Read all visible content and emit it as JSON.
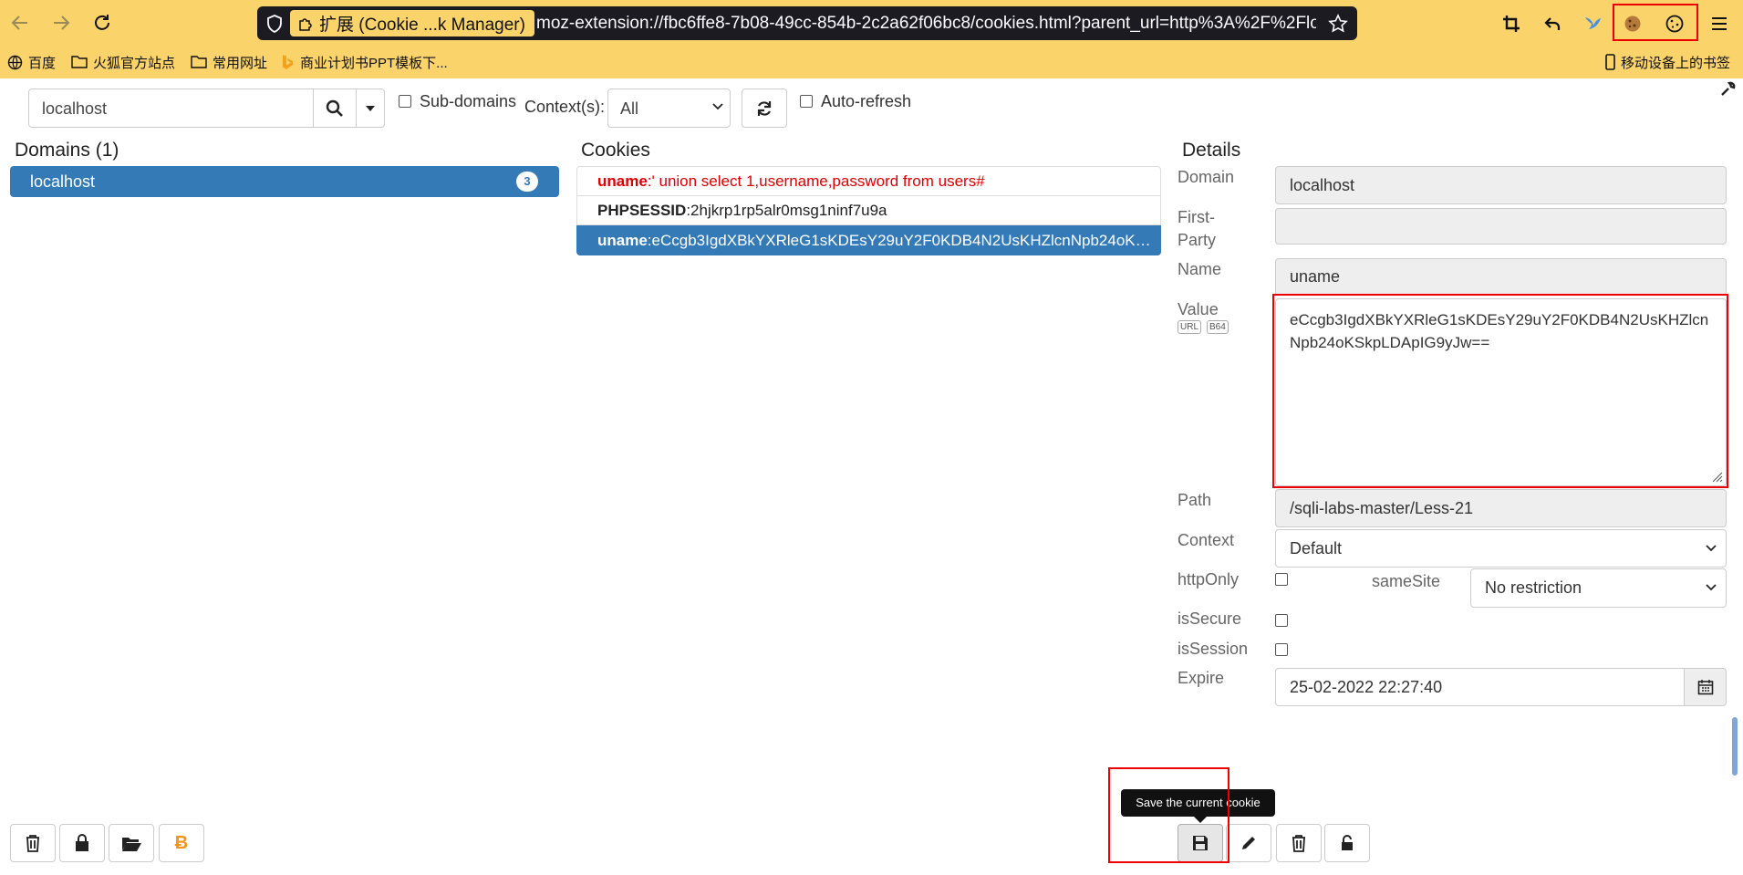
{
  "browser": {
    "tab_chip": "扩展 (Cookie ...k Manager)",
    "url": "moz-extension://fbc6ffe8-7b08-49cc-854b-2c2a62f06bc8/cookies.html?parent_url=http%3A%2F%2Flocalhost",
    "bookmarks": [
      "百度",
      "火狐官方站点",
      "常用网址",
      "商业计划书PPT模板下..."
    ],
    "mobile_bookmarks": "移动设备上的书签"
  },
  "toolbar": {
    "search_value": "localhost",
    "subdomains_label": "Sub-domains",
    "contexts_label": "Context(s):",
    "contexts_selected": "All",
    "autorefresh_label": "Auto-refresh"
  },
  "domains": {
    "header": "Domains (1)",
    "items": [
      {
        "name": "localhost",
        "count": "3"
      }
    ]
  },
  "cookies": {
    "header": "Cookies",
    "items": [
      {
        "name": "uname",
        "value": ":' union select 1,username,password from users#"
      },
      {
        "name": "PHPSESSID",
        "value": ":2hjkrp1rp5alr0msg1ninf7u9a"
      },
      {
        "name": "uname",
        "value": ":eCcgb3IgdXBkYXRleG1sKDEsY29uY2F0KDB4N2UsKHZlcnNpb24oKSkpLDApIG9yJw=="
      }
    ]
  },
  "details": {
    "header": "Details",
    "labels": {
      "domain": "Domain",
      "first_party_1": "First-",
      "first_party_2": "Party",
      "name": "Name",
      "value": "Value",
      "url_badge": "URL",
      "b64_badge": "B64",
      "path": "Path",
      "context": "Context",
      "httponly": "httpOnly",
      "samesite": "sameSite",
      "issecure": "isSecure",
      "issession": "isSession",
      "expire": "Expire"
    },
    "domain": "localhost",
    "first_party": "",
    "name": "uname",
    "value": "eCcgb3IgdXBkYXRleG1sKDEsY29uY2F0KDB4N2UsKHZlcnNpb24oKSkpLDApIG9yJw==",
    "path": "/sqli-labs-master/Less-21",
    "context": "Default",
    "samesite": "No restriction",
    "expire": "25-02-2022 22:27:40"
  },
  "tooltip": "Save the current cookie",
  "colors": {
    "chrome": "#fad36b",
    "selection": "#337ab7",
    "highlight_text": "#e00000",
    "annotation": "#e00000"
  },
  "icons": [
    "back-icon",
    "forward-icon",
    "reload-icon",
    "shield-icon",
    "puzzle-icon",
    "star-icon",
    "crop-icon",
    "undo-icon",
    "bird-icon",
    "cookie-icon",
    "cookie-icon",
    "menu-icon",
    "search-icon",
    "refresh-icon",
    "wrench-icon",
    "trash-icon",
    "lock-icon",
    "folder-open-icon",
    "bitcoin-icon",
    "save-icon",
    "pencil-icon",
    "trash-icon",
    "unlock-icon",
    "calendar-icon"
  ]
}
